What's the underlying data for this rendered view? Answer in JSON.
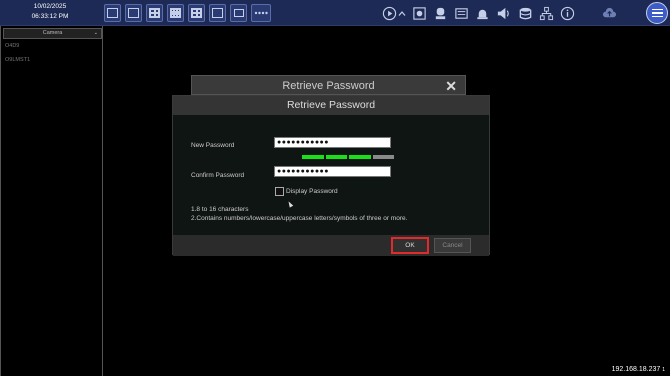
{
  "status": {
    "date": "10/02/2025",
    "time": "06:33:12 PM",
    "ip": "192.168.18.237"
  },
  "toolbar": {
    "layout_icons": [
      "single-view-icon",
      "quad-view-icon",
      "nine-view-icon",
      "sixteen-view-icon",
      "custom-layout-icon",
      "fullscreen-layout-icon",
      "sequence-icon",
      "multiscreen-icon"
    ],
    "action_icons": [
      "playback-icon",
      "snapshot-icon",
      "record-icon",
      "alarm-icon",
      "audio-icon",
      "disk-icon",
      "network-icon",
      "info-icon",
      "cloud-upload-icon"
    ],
    "menu_icon": "hamburger-menu-icon"
  },
  "left_panel": {
    "dropdown_value": "Camera",
    "cameras": [
      "O4D9",
      "O9LMST1"
    ]
  },
  "dialog": {
    "back_title": "Retrieve Password",
    "title": "Retrieve Password",
    "new_password_label": "New Password",
    "new_password_value": "●●●●●●●●●●●",
    "confirm_password_label": "Confirm Password",
    "confirm_password_value": "●●●●●●●●●●●",
    "strength_bars": [
      {
        "color": "#19e019"
      },
      {
        "color": "#19e019"
      },
      {
        "color": "#19e019"
      },
      {
        "color": "#8a8a8a"
      }
    ],
    "display_password_label": "Display Password",
    "display_password_checked": false,
    "hint_line1": "1.8 to 16 characters",
    "hint_line2": "2.Contains numbers/lowercase/uppercase letters/symbols of three or more.",
    "ok_label": "OK",
    "cancel_label": "Cancel"
  },
  "colors": {
    "accent": "#3d5cc7",
    "highlight": "#e12b2b",
    "strength_strong": "#19e019"
  }
}
